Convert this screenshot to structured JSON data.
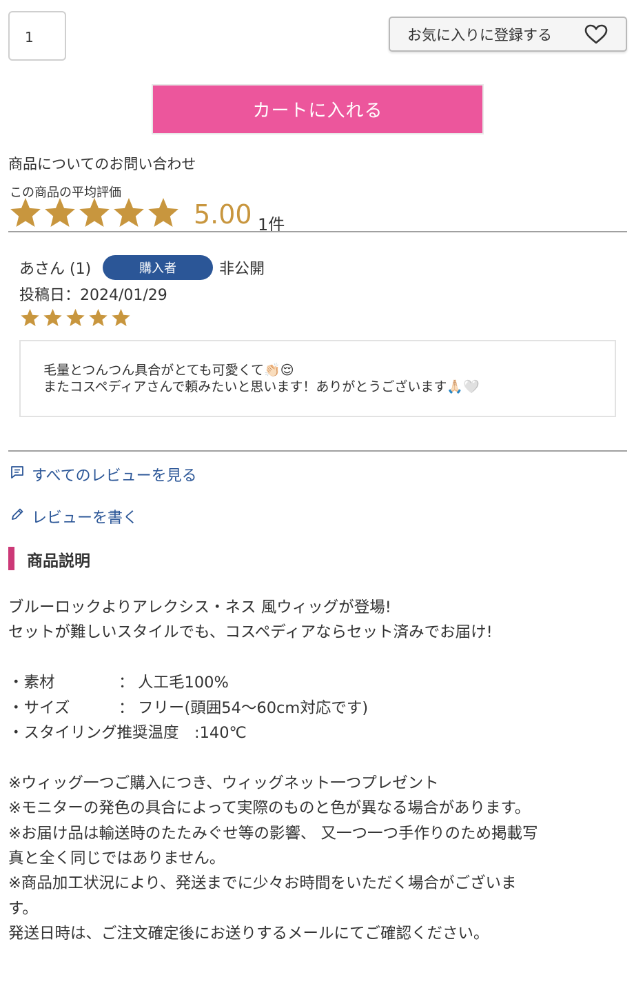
{
  "quantity": {
    "value": "1"
  },
  "favorite_button": {
    "label": "お気に入りに登録する",
    "icon": "heart-icon"
  },
  "cart_button": {
    "label": "カートに入れる",
    "color": "#ec569c"
  },
  "inquiry_link": {
    "label": "商品についてのお問い合わせ"
  },
  "rating": {
    "label": "この商品の平均評価",
    "stars": 5,
    "score": "5.00",
    "count": "1件",
    "star_color": "#c8963e"
  },
  "review": {
    "author": "あさん (1)",
    "badge": "購入者",
    "badge_color": "#2b5697",
    "visibility": "非公開",
    "date": "投稿日：2024/01/29",
    "stars": 5,
    "lines": [
      "毛量とつんつん具合がとても可愛くて👏🏻😌",
      "またコスペディアさんで頼みたいと思います！ありがとうございます🙏🏻🤍"
    ]
  },
  "links": {
    "all_reviews": "すべてのレビューを見る",
    "write_review": "レビューを書く",
    "color": "#2b5697"
  },
  "section": {
    "title": "商品説明",
    "accent_color": "#cc3977"
  },
  "description": {
    "intro": [
      "ブルーロックよりアレクシス・ネス 風ウィッグが登場!",
      "セットが難しいスタイルでも、コスペディアならセット済みでお届け!"
    ],
    "specs": [
      {
        "key": "・素材",
        "sep": "：",
        "value": "人工毛100%"
      },
      {
        "key": "・サイズ",
        "sep": "：",
        "value": "フリー(頭囲54〜60cm対応です)"
      }
    ],
    "styling": "・スタイリング推奨温度　:140℃",
    "notes": [
      "※ウィッグ一つご購入につき、ウィッグネット一つプレゼント",
      "※モニターの発色の具合によって実際のものと色が異なる場合があります。",
      "※お届け品は輸送時のたたみぐせ等の影響、 又一つ一つ手作りのため掲載写",
      "真と全く同じではありません。",
      "※商品加工状況により、発送までに少々お時間をいただく場合がございま",
      "す。",
      "発送日時は、ご注文確定後にお送りするメールにてご確認ください。"
    ]
  }
}
